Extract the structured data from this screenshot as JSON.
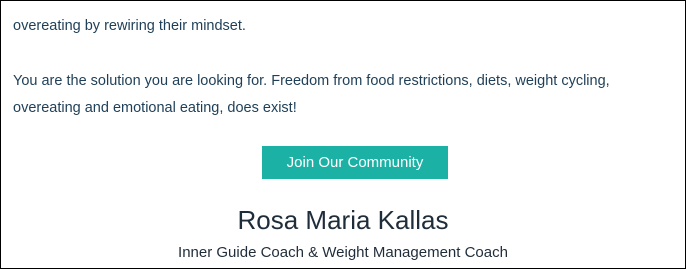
{
  "content": {
    "paragraph_1": "overeating by rewiring their mindset.",
    "paragraph_2": "You are the solution you are looking for. Freedom from food restrictions, diets, weight cycling, overeating and emotional eating, does exist!",
    "cta_label": "Join Our Community",
    "coach_name": "Rosa Maria Kallas",
    "coach_title": "Inner Guide Coach & Weight Management Coach"
  },
  "colors": {
    "body_text": "#1e3f57",
    "accent": "#1bb2a5",
    "heading": "#1f2d3a"
  }
}
